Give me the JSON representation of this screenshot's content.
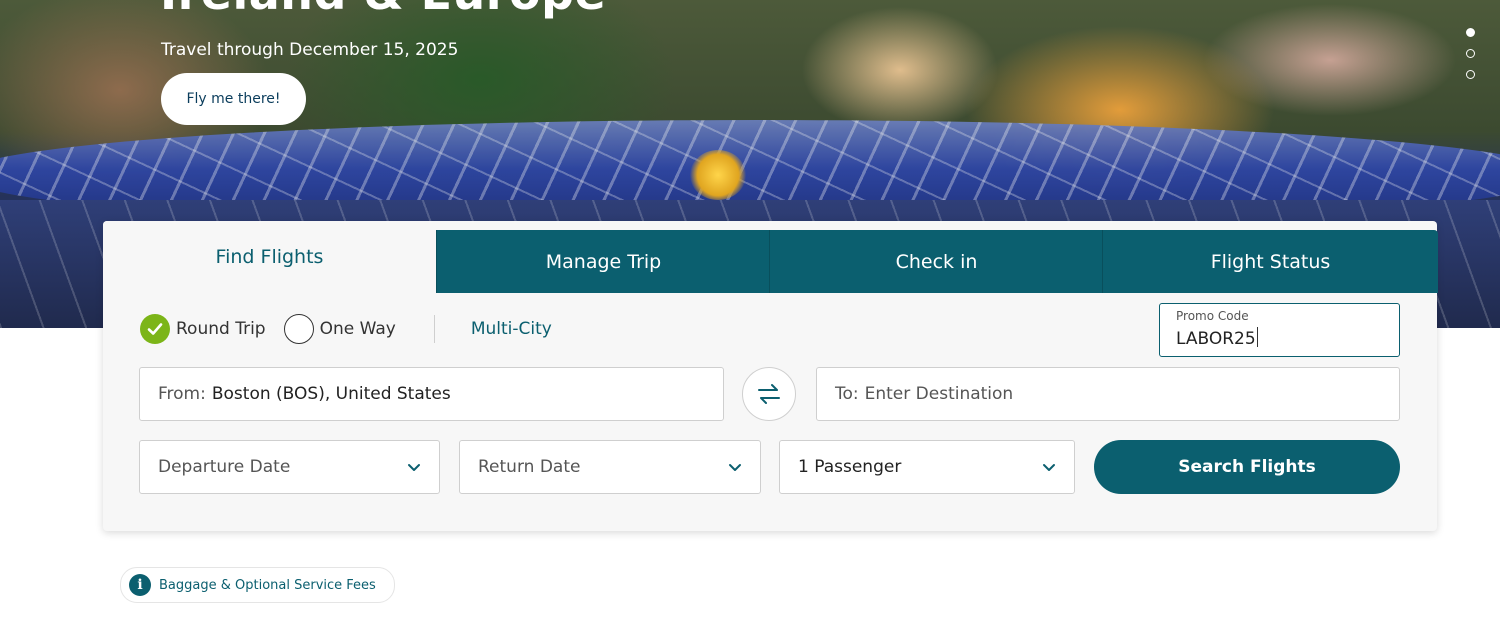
{
  "hero": {
    "title": "Ireland & Europe",
    "subtitle": "Travel through December 15, 2025",
    "cta_label": "Fly me there!",
    "carousel": {
      "slides": 3,
      "active_index": 0
    }
  },
  "tabs": [
    {
      "label": "Find Flights",
      "active": true
    },
    {
      "label": "Manage Trip",
      "active": false
    },
    {
      "label": "Check in",
      "active": false
    },
    {
      "label": "Flight Status",
      "active": false
    }
  ],
  "trip_type": {
    "round_trip": "Round Trip",
    "one_way": "One Way",
    "multi_city": "Multi-City",
    "selected": "Round Trip"
  },
  "promo": {
    "label": "Promo Code",
    "value": "LABOR25"
  },
  "from": {
    "label": "From:",
    "value": "Boston (BOS), United States"
  },
  "to": {
    "label": "To:",
    "placeholder": "Enter Destination"
  },
  "departure": {
    "placeholder": "Departure Date"
  },
  "return": {
    "placeholder": "Return Date"
  },
  "passengers": {
    "value": "1 Passenger"
  },
  "search_button": "Search Flights",
  "baggage_link": "Baggage & Optional Service Fees",
  "colors": {
    "teal": "#0b5f6f",
    "check_green": "#7cb518"
  },
  "icons": [
    "checkmark-icon",
    "swap-arrows-icon",
    "chevron-down-icon",
    "info-icon"
  ]
}
